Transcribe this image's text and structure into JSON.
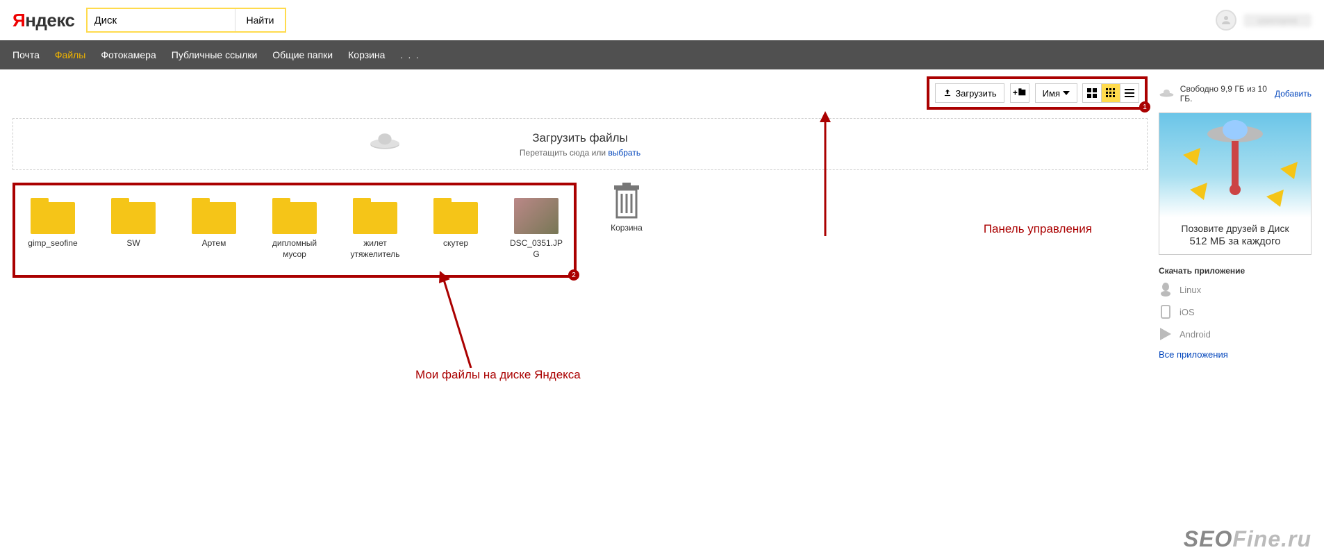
{
  "header": {
    "logo_black": "Я",
    "logo_rest": "ндекс",
    "search_value": "Диск",
    "search_button": "Найти",
    "username": "username"
  },
  "nav": {
    "items": [
      {
        "label": "Почта",
        "active": false
      },
      {
        "label": "Файлы",
        "active": true
      },
      {
        "label": "Фотокамера",
        "active": false
      },
      {
        "label": "Публичные ссылки",
        "active": false
      },
      {
        "label": "Общие папки",
        "active": false
      },
      {
        "label": "Корзина",
        "active": false
      }
    ]
  },
  "toolbar": {
    "upload": "Загрузить",
    "sort": "Имя"
  },
  "storage": {
    "text": "Свободно 9,9 ГБ из 10 ГБ.",
    "add": "Добавить"
  },
  "dropzone": {
    "title": "Загрузить файлы",
    "sub_pre": "Перетащить сюда или ",
    "sub_link": "выбрать"
  },
  "files": [
    {
      "name": "gimp_seofine",
      "type": "folder"
    },
    {
      "name": "SW",
      "type": "folder"
    },
    {
      "name": "Артем",
      "type": "folder"
    },
    {
      "name": "дипломный мусор",
      "type": "folder"
    },
    {
      "name": "жилет утяжелитель",
      "type": "folder"
    },
    {
      "name": "скутер",
      "type": "folder"
    },
    {
      "name": "DSC_0351.JPG",
      "type": "image"
    }
  ],
  "trash_label": "Корзина",
  "promo": {
    "title": "Позовите друзей в Диск",
    "sub": "512 МБ за каждого"
  },
  "apps": {
    "title": "Скачать приложение",
    "items": [
      {
        "label": "Linux"
      },
      {
        "label": "iOS"
      },
      {
        "label": "Android"
      }
    ],
    "all": "Все приложения"
  },
  "annotations": {
    "panel": "Панель управления",
    "files": "Мои файлы на диске Яндекса",
    "badge1": "1",
    "badge2": "2"
  },
  "watermark": {
    "seo": "SEO",
    "fine": "Fine.ru"
  }
}
